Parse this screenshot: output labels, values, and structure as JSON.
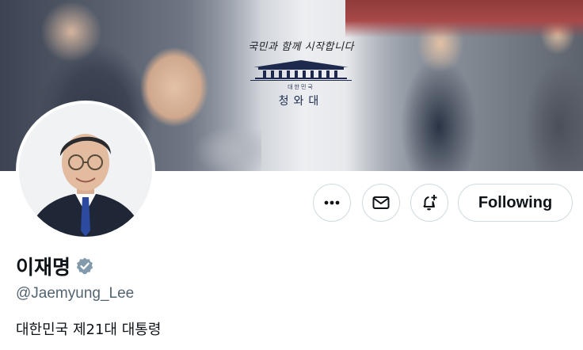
{
  "banner": {
    "slogan": "국민과 함께 시작합니다",
    "org_small": "대한민국",
    "org_name": "청와대"
  },
  "profile": {
    "display_name": "이재명",
    "verified_icon": "verified-badge-icon",
    "handle": "@Jaemyung_Lee",
    "bio": "대한민국 제21대 대통령"
  },
  "actions": {
    "more_icon": "more-horizontal-icon",
    "message_icon": "envelope-icon",
    "notify_icon": "bell-plus-icon",
    "follow_label": "Following"
  },
  "colors": {
    "text_primary": "#0f1419",
    "text_secondary": "#536471",
    "border": "#cfd9de",
    "verified_badge": "#829aab"
  }
}
